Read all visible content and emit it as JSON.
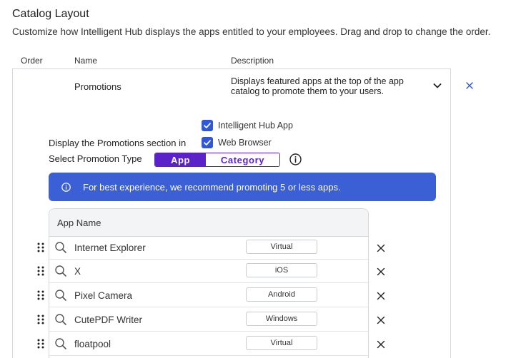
{
  "header": {
    "title": "Catalog Layout",
    "subtitle": "Customize how Intelligent Hub displays the apps entitled to your employees. Drag and drop to change the order."
  },
  "columns": {
    "order": "Order",
    "name": "Name",
    "description": "Description"
  },
  "section_row": {
    "name": "Promotions",
    "description": "Displays featured apps at the top of the app catalog to promote them to your users."
  },
  "display": {
    "label": "Display the Promotions section in",
    "options": [
      {
        "label": "Intelligent Hub App",
        "checked": true
      },
      {
        "label": "Web Browser",
        "checked": true
      }
    ]
  },
  "promotion_type": {
    "label": "Select Promotion Type",
    "options": [
      "App",
      "Category"
    ],
    "selected": "App"
  },
  "banner": {
    "text": "For best experience, we recommend promoting 5 or less apps."
  },
  "apps_table": {
    "header": "App Name",
    "rows": [
      {
        "name": "Internet Explorer",
        "platform": "Virtual"
      },
      {
        "name": "X",
        "platform": "iOS"
      },
      {
        "name": "Pixel Camera",
        "platform": "Android"
      },
      {
        "name": "CutePDF Writer",
        "platform": "Windows"
      },
      {
        "name": "floatpool",
        "platform": "Virtual"
      }
    ]
  },
  "colors": {
    "accent": "#5b22c9",
    "banner": "#3b5fd4",
    "checkbox": "#2f57d8",
    "link": "#2f57d8"
  }
}
